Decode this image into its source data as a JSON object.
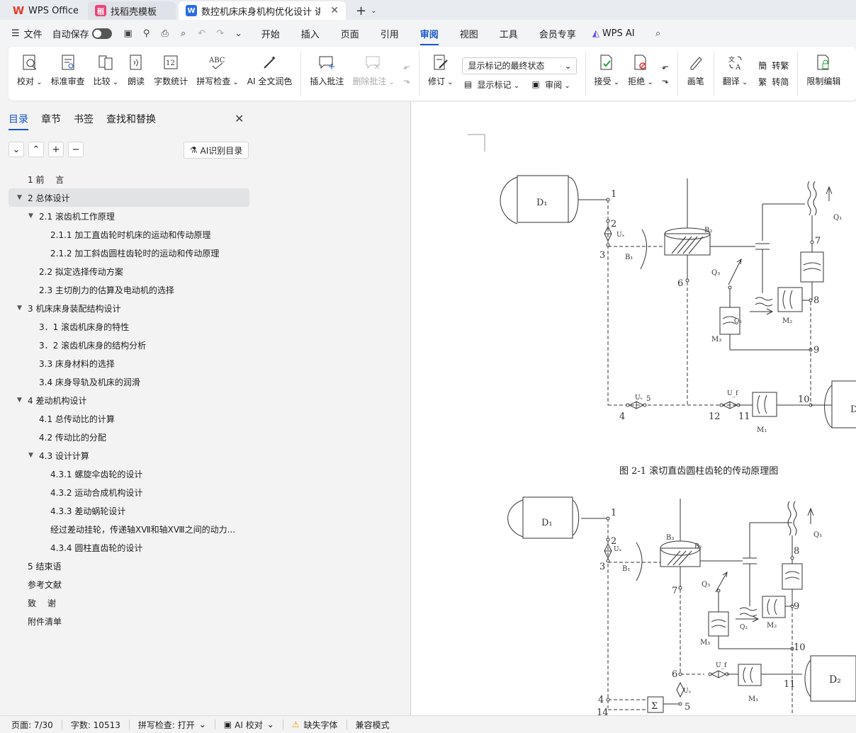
{
  "tabs": [
    {
      "label": "WPS Office"
    },
    {
      "label": "找稻壳模板"
    },
    {
      "label": "数控机床床身机构优化设计 讲"
    }
  ],
  "menubar": {
    "file": "文件",
    "autosave": "自动保存",
    "tabs": [
      "开始",
      "插入",
      "页面",
      "引用",
      "审阅",
      "视图",
      "工具",
      "会员专享"
    ],
    "active_tab": "审阅",
    "wps_ai": "WPS AI"
  },
  "ribbon": {
    "proofread": "校对",
    "standard_review": "标准审查",
    "compare": "比较",
    "read_aloud": "朗读",
    "word_count": "字数统计",
    "spell_check": "拼写检查",
    "ai_polish": "AI 全文润色",
    "insert_comment": "插入批注",
    "delete_comment": "删除批注",
    "track_changes": "修订",
    "display_select": "显示标记的最终状态",
    "show_markup": "显示标记",
    "review": "审阅",
    "accept": "接受",
    "reject": "拒绝",
    "pen": "画笔",
    "translate": "翻译",
    "to_traditional": "转繁",
    "to_simplified": "转简",
    "restrict_edit": "限制编辑"
  },
  "leftpanel": {
    "tabs": [
      "目录",
      "章节",
      "书签",
      "查找和替换"
    ],
    "ai_toc": "AI识别目录",
    "toc": [
      {
        "text": "1 前　 言",
        "level": 1,
        "arrow": false
      },
      {
        "text": "2 总体设计",
        "level": 1,
        "arrow": true,
        "selected": true
      },
      {
        "text": "2.1 滚齿机工作原理",
        "level": 2,
        "arrow": true
      },
      {
        "text": "2.1.1 加工直齿轮时机床的运动和传动原理",
        "level": 3
      },
      {
        "text": "2.1.2 加工斜齿圆柱齿轮时的运动和传动原理",
        "level": 3
      },
      {
        "text": "2.2 拟定选择传动方案",
        "level": 2
      },
      {
        "text": "2.3  主切削力的估算及电动机的选择",
        "level": 2
      },
      {
        "text": "3 机床床身装配结构设计",
        "level": 1,
        "arrow": true
      },
      {
        "text": "3．1 滚齿机床身的特性",
        "level": 2
      },
      {
        "text": "3．2 滚齿机床身的结构分析",
        "level": 2
      },
      {
        "text": "3.3  床身材料的选择",
        "level": 2
      },
      {
        "text": "3.4  床身导轨及机床的润滑",
        "level": 2
      },
      {
        "text": "4 差动机构设计",
        "level": 1,
        "arrow": true
      },
      {
        "text": "4.1  总传动比的计算",
        "level": 2
      },
      {
        "text": "4.2  传动比的分配",
        "level": 2
      },
      {
        "text": "4.3  设计计算",
        "level": 2,
        "arrow": true
      },
      {
        "text": "4.3.1  螺旋伞齿轮的设计",
        "level": 3
      },
      {
        "text": "4.3.2  运动合成机构设计",
        "level": 3
      },
      {
        "text": "4.3.3 差动蜗轮设计",
        "level": 3
      },
      {
        "text": "经过差动挂轮，传递轴ⅩⅦ和轴ⅩⅧ之间的动力...",
        "level": 3
      },
      {
        "text": "4.3.4 圆柱直齿轮的设计",
        "level": 3
      },
      {
        "text": "5  结束语",
        "level": 1
      },
      {
        "text": "参考文献",
        "level": 1
      },
      {
        "text": "致　 谢",
        "level": 1
      },
      {
        "text": "附件清单",
        "level": 1
      }
    ]
  },
  "document": {
    "caption": "图 2-1  滚切直齿圆柱齿轮的传动原理图",
    "fig1": {
      "d1": "D₁",
      "b1": "B₁",
      "b2": "B₂",
      "q1": "Q₁",
      "q2": "Q₂",
      "q3": "Q₃",
      "m1": "M₁",
      "m2": "M₂",
      "m3": "M₃",
      "ux": "Uₓ",
      "uv": "Uᵥ",
      "uf": "U_f",
      "d_cut": "D",
      "nums": [
        "1",
        "2",
        "3",
        "4",
        "5",
        "6",
        "7",
        "8",
        "9",
        "10",
        "11",
        "12"
      ]
    },
    "fig2": {
      "d1": "D₁",
      "d2": "D₂",
      "b1": "B₁",
      "b2": "B₂",
      "b3": "B₃",
      "q1": "Q₁",
      "q2": "Q₂",
      "q3": "Q₃",
      "m1": "M₁",
      "m2": "M₂",
      "m3": "M₃",
      "ux": "Uₓ",
      "uf": "U_f",
      "uy": "Uᵧ",
      "sigma": "Σ",
      "nums": [
        "1",
        "2",
        "3",
        "4",
        "5",
        "6",
        "7",
        "8",
        "9",
        "10",
        "11",
        "14"
      ]
    }
  },
  "statusbar": {
    "page": "页面: 7/30",
    "words": "字数: 10513",
    "spell": "拼写检查: 打开",
    "ai_proof": "AI 校对",
    "missing_font": "缺失字体",
    "compat": "兼容模式"
  }
}
